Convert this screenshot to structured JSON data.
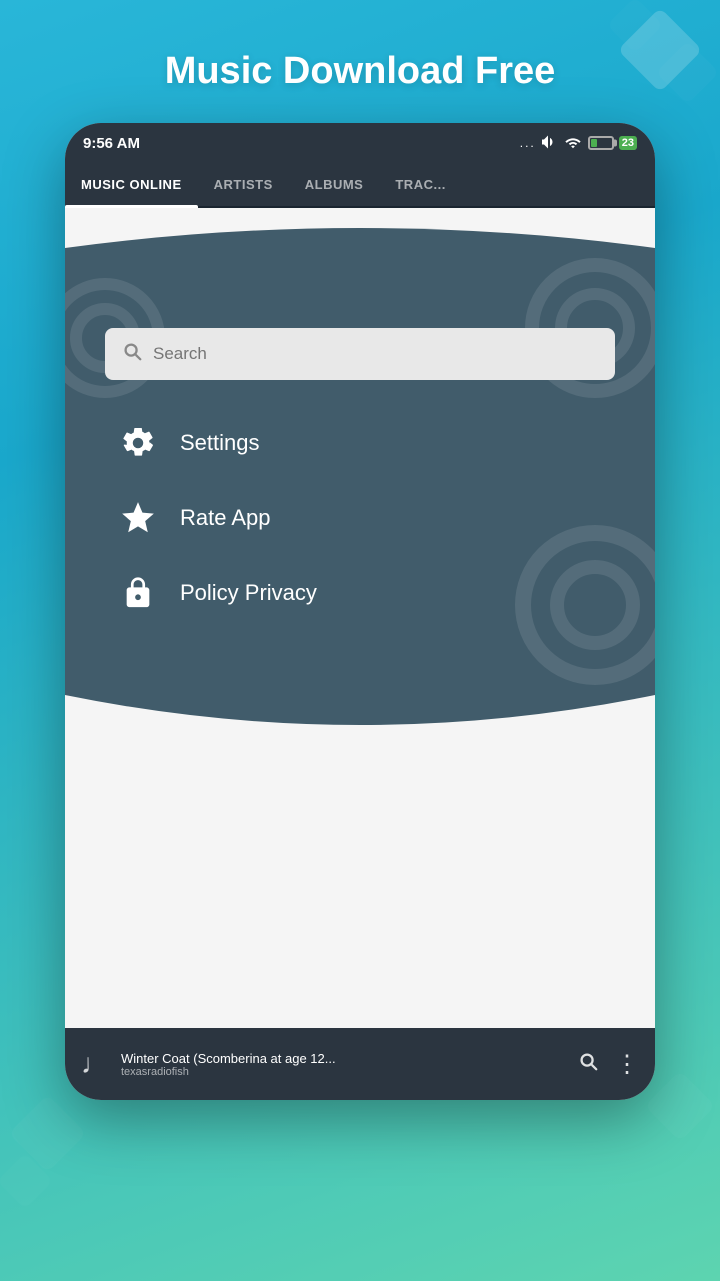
{
  "page": {
    "title": "Music Download Free"
  },
  "status_bar": {
    "time": "9:56  AM",
    "battery_percent": "23",
    "dots": "...",
    "volume_icon": "🔈",
    "wifi_icon": "WiFi"
  },
  "nav_tabs": [
    {
      "id": "music-online",
      "label": "MUSIC ONLINE",
      "active": true
    },
    {
      "id": "artists",
      "label": "ARTISTS",
      "active": false
    },
    {
      "id": "albums",
      "label": "ALBUMS",
      "active": false
    },
    {
      "id": "tracks",
      "label": "TRAC...",
      "active": false
    }
  ],
  "search": {
    "placeholder": "Search"
  },
  "menu": {
    "items": [
      {
        "id": "settings",
        "label": "Settings",
        "icon": "gear"
      },
      {
        "id": "rate-app",
        "label": "Rate App",
        "icon": "star"
      },
      {
        "id": "policy-privacy",
        "label": "Policy Privacy",
        "icon": "lock"
      }
    ]
  },
  "player": {
    "title": "Winter Coat (Scomberina at age 12...",
    "artist": "texasradiofish",
    "music_note": "♩"
  }
}
